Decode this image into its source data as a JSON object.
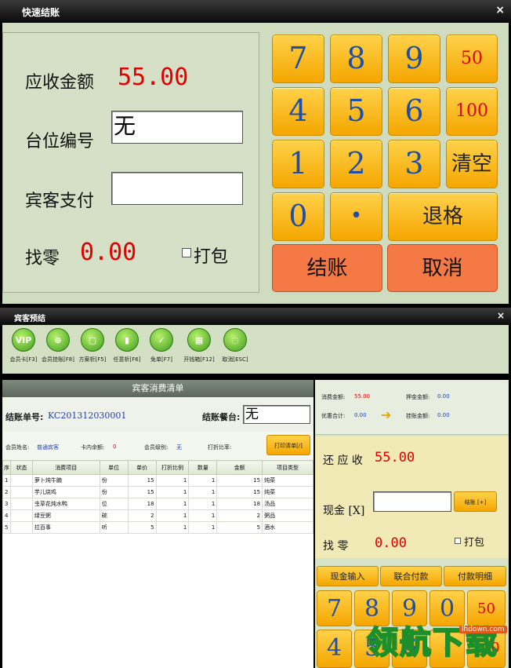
{
  "win1": {
    "title": "快速结账",
    "close": "×",
    "receivable_label": "应收金额",
    "receivable_value": "55.00",
    "table_no_label": "台位编号",
    "table_no_value": "无",
    "guest_pay_label": "宾客支付",
    "guest_pay_value": "",
    "change_label": "找零",
    "change_value": "0.00",
    "pack_label": "打包",
    "keys": {
      "k7": "7",
      "k8": "8",
      "k9": "9",
      "k50": "50",
      "k4": "4",
      "k5": "5",
      "k6": "6",
      "k100": "100",
      "k1": "1",
      "k2": "2",
      "k3": "3",
      "clear": "清空",
      "k0": "0",
      "dot": "•",
      "backspace": "退格",
      "checkout": "结账",
      "cancel": "取消"
    }
  },
  "win2": {
    "title": "宾客预结",
    "close": "×",
    "toolbar": [
      {
        "icon": "VIP",
        "label": "会员卡[F3]",
        "icon_name": "vip-card-icon"
      },
      {
        "icon": "",
        "label": "会员挂账[F8]",
        "icon_name": "member-credit-icon"
      },
      {
        "icon": "",
        "label": "方案析[F5]",
        "icon_name": "plan-discount-icon"
      },
      {
        "icon": "",
        "label": "任意析[F6]",
        "icon_name": "any-discount-icon"
      },
      {
        "icon": "",
        "label": "免单[F7]",
        "icon_name": "free-order-icon"
      },
      {
        "icon": "",
        "label": "开钱箱[F12]",
        "icon_name": "cash-drawer-icon"
      },
      {
        "icon": "",
        "label": "取消[ESC]",
        "icon_name": "cancel-icon"
      }
    ],
    "bill_header": "宾客消费清单",
    "bill_no_label": "结账单号:",
    "bill_no_value": "KC201312030001",
    "table_label": "结账餐台:",
    "table_value": "无",
    "member_name_label": "会员姓名:",
    "member_name_value": "普通宾客",
    "card_balance_label": "卡内余额:",
    "card_balance_value": "0",
    "member_level_label": "会员级别:",
    "member_level_value": "无",
    "discount_rate_label": "打折比率:",
    "print_button": "打印清单[/]",
    "columns": [
      "序",
      "状态",
      "消费项目",
      "单位",
      "单价",
      "打折比例",
      "数量",
      "金额",
      "项目类型"
    ],
    "rows": [
      [
        "1",
        "",
        "萝卜炖牛腩",
        "份",
        "15",
        "1",
        "1",
        "15",
        "炖菜"
      ],
      [
        "2",
        "",
        "芋儿烧鸡",
        "份",
        "15",
        "1",
        "1",
        "15",
        "炖菜"
      ],
      [
        "3",
        "",
        "虫草花炖水鸭",
        "位",
        "18",
        "1",
        "1",
        "18",
        "汤品"
      ],
      [
        "4",
        "",
        "绿豆粥",
        "碗",
        "2",
        "1",
        "1",
        "2",
        "粥品"
      ],
      [
        "5",
        "",
        "拉百事",
        "听",
        "5",
        "1",
        "1",
        "5",
        "酒水"
      ]
    ],
    "summary": {
      "consume_label": "消费金额:",
      "consume_value": "55.00",
      "deposit_label": "押金金额:",
      "deposit_value": "0.00",
      "discount_label": "优惠合计:",
      "discount_value": "0.00",
      "credit_label": "挂账金额:",
      "credit_value": "0.00"
    },
    "pay": {
      "receivable_label": "还 应 收",
      "receivable_value": "55.00",
      "cash_label": "现金 [X]",
      "cash_value": "",
      "checkout_button": "结账 [+]",
      "change_label": "找    零",
      "change_value": "0.00",
      "pack_label": "打包"
    },
    "tabs": [
      "现金输入",
      "联合付款",
      "付款明细"
    ],
    "keys": {
      "r1": [
        "7",
        "8",
        "9",
        "0",
        "50"
      ],
      "r2": [
        "4",
        "5",
        "6",
        "•",
        "100"
      ]
    }
  },
  "watermark": {
    "text": "领航下载",
    "site": "lhdown.com"
  },
  "colors": {
    "accent_orange": "#f5a600",
    "action_orange": "#f57944",
    "amount_red": "#e00000",
    "digit_blue": "#1f4fa6",
    "panel_green": "#d0dcc0"
  }
}
